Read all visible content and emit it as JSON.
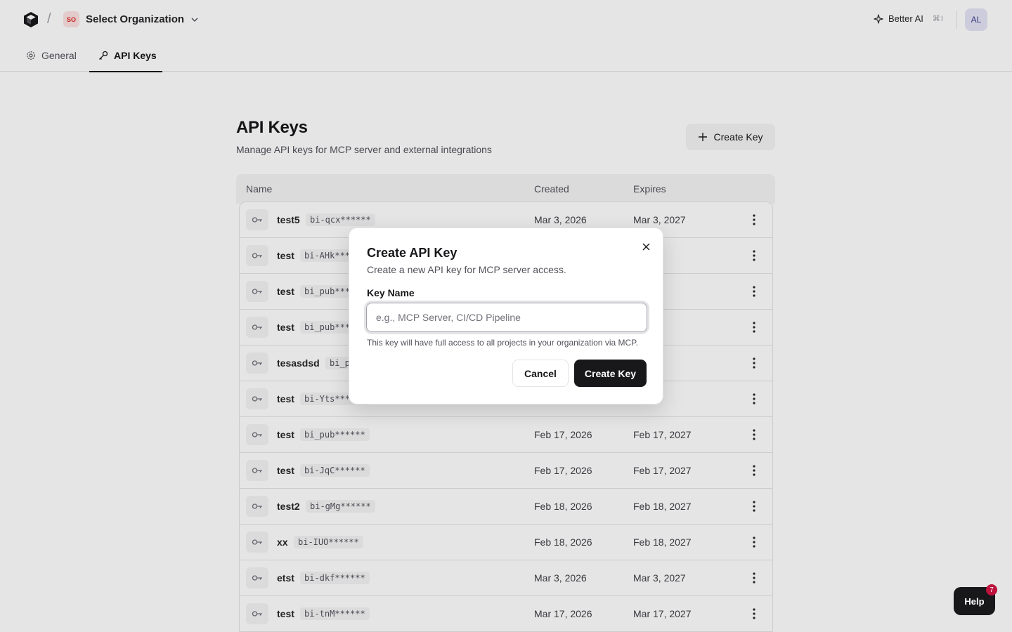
{
  "header": {
    "separator": "/",
    "org_badge": "SO",
    "org_name": "Select Organization",
    "better_ai_label": "Better AI",
    "better_ai_shortcut": "⌘I",
    "avatar_initials": "AL"
  },
  "tabs": [
    {
      "label": "General",
      "icon": "gear-icon",
      "active": false
    },
    {
      "label": "API Keys",
      "icon": "key-icon",
      "active": true
    }
  ],
  "main": {
    "title": "API Keys",
    "subtitle": "Manage API keys for MCP server and external integrations",
    "create_key_label": "Create Key",
    "columns": {
      "name": "Name",
      "created": "Created",
      "expires": "Expires"
    },
    "rows": [
      {
        "name": "test5",
        "prefix": "bi-qcx******",
        "created": "Mar 3, 2026",
        "expires": "Mar 3, 2027"
      },
      {
        "name": "test",
        "prefix": "bi-AHk******",
        "created": "",
        "expires": "2027"
      },
      {
        "name": "test",
        "prefix": "bi_pub******",
        "created": "",
        "expires": "2027"
      },
      {
        "name": "test",
        "prefix": "bi_pub******",
        "created": "",
        "expires": "2027"
      },
      {
        "name": "tesasdsd",
        "prefix": "bi_pub******",
        "created": "",
        "expires": "2027"
      },
      {
        "name": "test",
        "prefix": "bi-Yts******",
        "created": "",
        "expires": ", 2027"
      },
      {
        "name": "test",
        "prefix": "bi_pub******",
        "created": "Feb 17, 2026",
        "expires": "Feb 17, 2027"
      },
      {
        "name": "test",
        "prefix": "bi-JqC******",
        "created": "Feb 17, 2026",
        "expires": "Feb 17, 2027"
      },
      {
        "name": "test2",
        "prefix": "bi-gMg******",
        "created": "Feb 18, 2026",
        "expires": "Feb 18, 2027"
      },
      {
        "name": "xx",
        "prefix": "bi-IUO******",
        "created": "Feb 18, 2026",
        "expires": "Feb 18, 2027"
      },
      {
        "name": "etst",
        "prefix": "bi-dkf******",
        "created": "Mar 3, 2026",
        "expires": "Mar 3, 2027"
      },
      {
        "name": "test",
        "prefix": "bi-tnM******",
        "created": "Mar 17, 2026",
        "expires": "Mar 17, 2027"
      }
    ]
  },
  "modal": {
    "title": "Create API Key",
    "description": "Create a new API key for MCP server access.",
    "field_label": "Key Name",
    "field_value": "",
    "field_placeholder": "e.g., MCP Server, CI/CD Pipeline",
    "hint": "This key will have full access to all projects in your organization via MCP.",
    "cancel_label": "Cancel",
    "create_label": "Create Key"
  },
  "help": {
    "label": "Help",
    "badge": "7"
  }
}
